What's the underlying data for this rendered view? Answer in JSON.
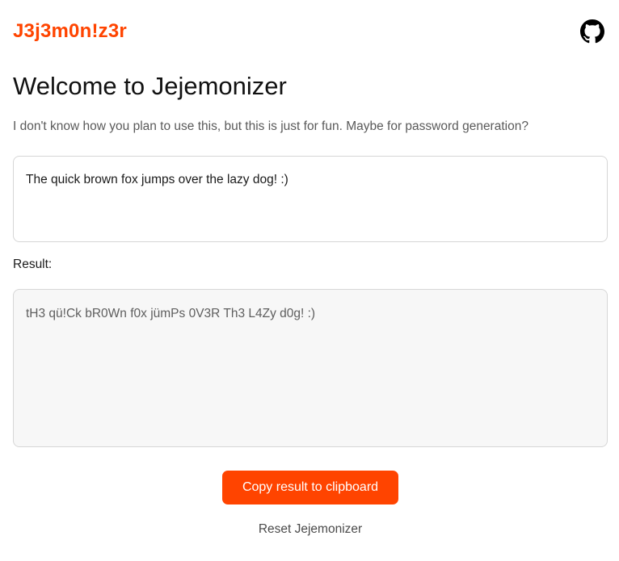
{
  "header": {
    "logo_text": "J3j3m0n!z3r",
    "github_icon": "github-icon"
  },
  "main": {
    "title": "Welcome to Jejemonizer",
    "subtitle": "I don't know how you plan to use this, but this is just for fun. Maybe for password generation?",
    "input_value": "The quick brown fox jumps over the lazy dog! :)",
    "result_label": "Result:",
    "output_value": "tH3 qü!Ck bR0Wn f0x jümPs 0V3R Th3 L4Zy d0g! :)",
    "copy_button_label": "Copy result to clipboard",
    "reset_button_label": "Reset Jejemonizer"
  },
  "colors": {
    "accent": "#ff4400",
    "output_background": "#f7f7f7",
    "border": "#d6d6d6"
  }
}
